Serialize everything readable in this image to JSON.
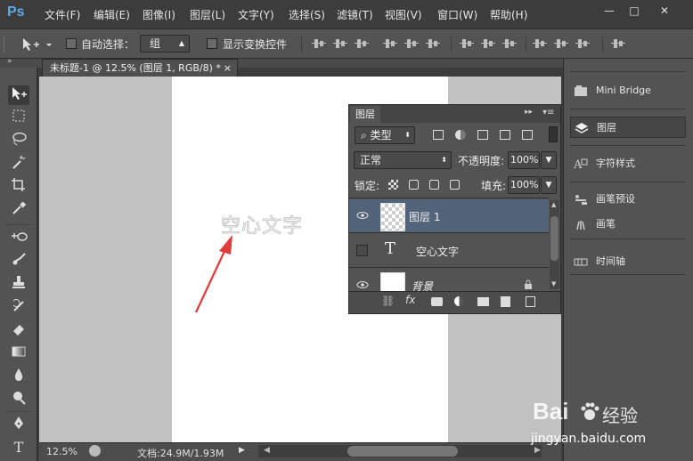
{
  "app": {
    "logo": "Ps"
  },
  "menu": [
    "文件(F)",
    "编辑(E)",
    "图像(I)",
    "图层(L)",
    "文字(Y)",
    "选择(S)",
    "滤镜(T)",
    "视图(V)",
    "窗口(W)",
    "帮助(H)"
  ],
  "window_controls": {
    "minimize": "—",
    "maximize": "□",
    "close": "✕"
  },
  "options_bar": {
    "auto_select_label": "自动选择：",
    "auto_select_value": "组",
    "show_transform_label": "显示变换控件"
  },
  "document": {
    "tab_title": "未标题-1 @ 12.5% (图层 1, RGB/8) *",
    "tab_close": "×",
    "canvas_text": "空心文字"
  },
  "status": {
    "zoom": "12.5%",
    "doc_info": "文档:24.9M/1.93M"
  },
  "layers_panel": {
    "tab_label": "图层",
    "filter_label": "类型",
    "blend_mode": "正常",
    "opacity_label": "不透明度:",
    "opacity_value": "100%",
    "lock_label": "锁定:",
    "fill_label": "填充:",
    "fill_value": "100%",
    "layers": [
      {
        "name": "图层 1",
        "visible": true,
        "selected": true,
        "kind": "pixel"
      },
      {
        "name": "空心文字",
        "visible": false,
        "selected": false,
        "kind": "text"
      },
      {
        "name": "背景",
        "visible": true,
        "selected": false,
        "kind": "background"
      }
    ],
    "text_layer_glyph": "T",
    "footer_fx": "fx"
  },
  "right_panel": {
    "items": [
      {
        "label": "Mini Bridge",
        "icon": "mini-bridge-icon"
      },
      {
        "label": "图层",
        "icon": "layers-icon"
      },
      {
        "label": "字符样式",
        "icon": "character-style-icon"
      },
      {
        "label": "画笔预设",
        "icon": "brush-preset-icon"
      },
      {
        "label": "画笔",
        "icon": "brush-icon"
      },
      {
        "label": "时间轴",
        "icon": "timeline-icon"
      }
    ]
  },
  "watermark": {
    "brand": "Bai",
    "brand2": "经验",
    "url": "jingyan.baidu.com"
  },
  "colors": {
    "selected_layer": "#536379",
    "accent": "#5fa8e8",
    "arrow": "#e03a3a"
  }
}
